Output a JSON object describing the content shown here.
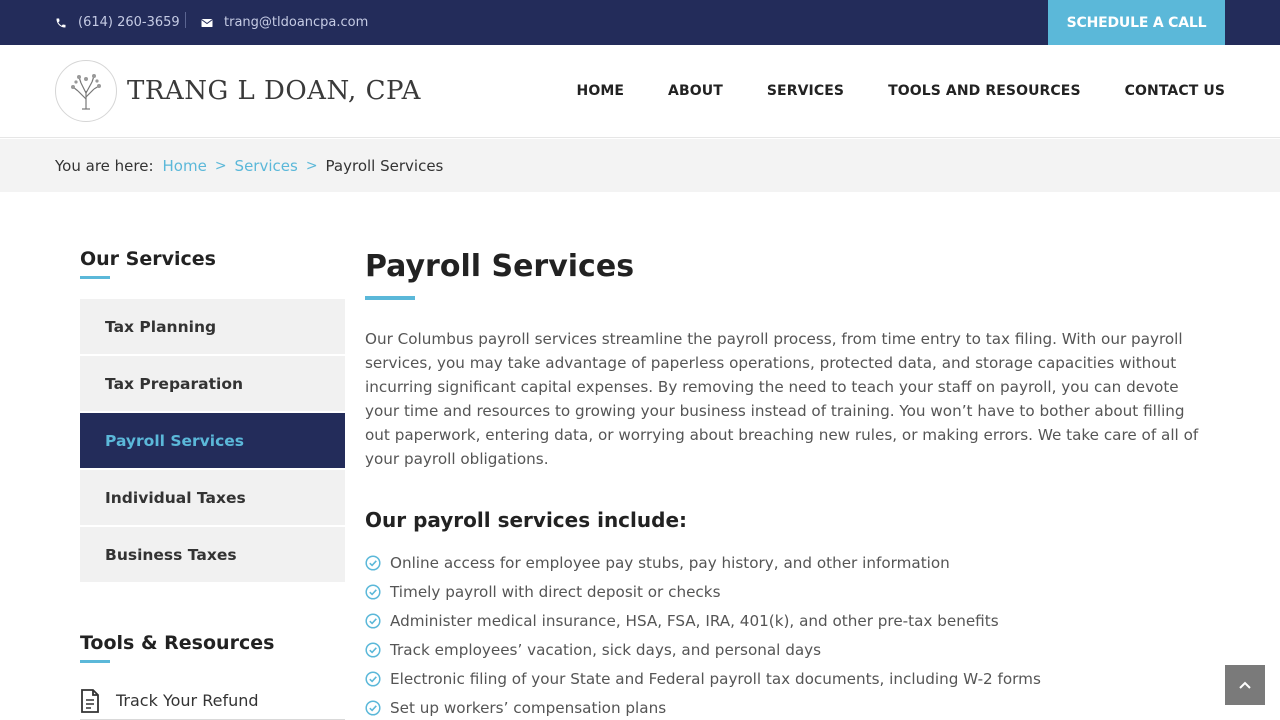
{
  "topbar": {
    "phone": "(614) 260-3659",
    "email": "trang@tldoancpa.com",
    "schedule_label": "SCHEDULE A CALL"
  },
  "header": {
    "logo_text": "TRANG L DOAN, CPA",
    "nav": [
      {
        "label": "HOME"
      },
      {
        "label": "ABOUT"
      },
      {
        "label": "SERVICES"
      },
      {
        "label": "TOOLS AND RESOURCES"
      },
      {
        "label": "CONTACT US"
      }
    ]
  },
  "breadcrumb": {
    "prefix": "You are here:",
    "items": [
      "Home",
      "Services"
    ],
    "separator": ">",
    "current": "Payroll Services"
  },
  "sidebar": {
    "heading": "Our Services",
    "services": [
      {
        "label": "Tax Planning"
      },
      {
        "label": "Tax Preparation"
      },
      {
        "label": "Payroll Services"
      },
      {
        "label": "Individual Taxes"
      },
      {
        "label": "Business Taxes"
      }
    ],
    "tools_heading": "Tools & Resources",
    "tools": [
      {
        "label": "Track Your Refund",
        "icon": "document-icon"
      }
    ]
  },
  "main": {
    "title": "Payroll Services",
    "intro": "Our Columbus payroll services streamline the payroll process, from time entry to tax filing. With our payroll services, you may take advantage of paperless operations, protected data, and storage capacities without incurring significant capital expenses. By removing the need to teach your staff on payroll, you can devote your time and resources to growing your business instead of training. You won’t have to bother about filling out paperwork, entering data, or worrying about breaching new rules, or making errors. We take care of all of your payroll obligations.",
    "list_heading": "Our payroll services include:",
    "features": [
      "Online access for employee pay stubs, pay history, and other information",
      "Timely payroll with direct deposit or checks",
      "Administer medical insurance, HSA, FSA, IRA, 401(k), and other pre-tax benefits",
      "Track employees’ vacation, sick days, and personal days",
      "Electronic filing of your State and Federal payroll tax documents, including W-2 forms",
      "Set up workers’ compensation plans"
    ]
  },
  "colors": {
    "navy": "#232c5a",
    "accent": "#5bb8d9",
    "sidebar_bg": "#f1f1f1"
  }
}
